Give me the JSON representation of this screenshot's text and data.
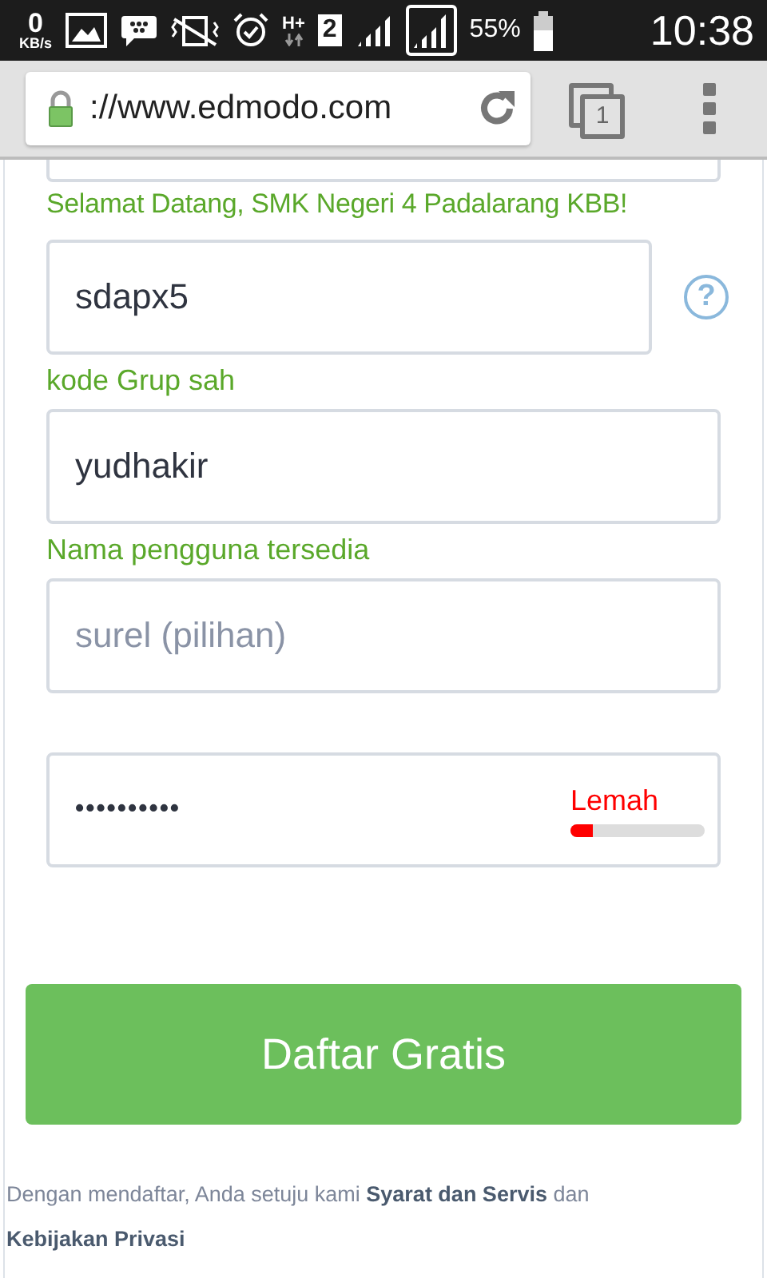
{
  "status_bar": {
    "speed": "0",
    "speed_unit": "KB/s",
    "network": "H+",
    "sim": "2",
    "battery": "55%",
    "time": "10:38"
  },
  "browser": {
    "url": "://www.edmodo.com",
    "tab_count": "1"
  },
  "welcome": "Selamat Datang, SMK Negeri 4 Padalarang KBB!",
  "fields": [
    {
      "kind": "code",
      "value": "sdapx5",
      "help": "?",
      "note": "kode Grup sah"
    },
    {
      "kind": "text",
      "value": "yudhakir",
      "note": "Nama pengguna tersedia"
    },
    {
      "kind": "text",
      "placeholder": "surel (pilihan)"
    },
    {
      "kind": "password",
      "value": "••••••••••",
      "strength": "Lemah",
      "level": 0.17,
      "color": "#ff0000"
    }
  ],
  "submit": "Daftar Gratis",
  "terms": {
    "text": "Dengan mendaftar, Anda setuju kami",
    "link1": "Syarat dan Servis",
    "joiner": "dan",
    "link2": "Kebijakan Privasi"
  }
}
